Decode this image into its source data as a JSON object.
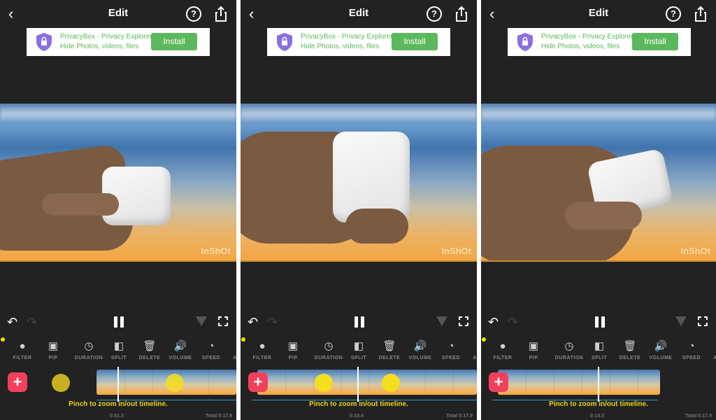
{
  "common": {
    "title": "Edit",
    "back_icon": "chevron-left-icon",
    "help_icon": "help-icon",
    "help_glyph": "?",
    "share_icon": "share-icon",
    "ad": {
      "line1": "PrivacyBox - Privacy Explorer",
      "line2": "Hide Photos, videos, files",
      "button": "Install"
    },
    "watermark": "InShOt",
    "undo_glyph": "↶",
    "redo_glyph": "↷",
    "add_glyph": "+",
    "hint": "Pinch to zoom in/out timeline.",
    "total": "Total 0:17.9",
    "tools": [
      {
        "label": "FILTER",
        "icon": "filter-icon",
        "glyph": "●"
      },
      {
        "label": "PIP",
        "icon": "pip-icon",
        "glyph": "▣"
      },
      {
        "label": "DURATION",
        "icon": "clock-icon",
        "glyph": "◷"
      },
      {
        "label": "SPLIT",
        "icon": "split-icon",
        "glyph": "◧"
      },
      {
        "label": "DELETE",
        "icon": "trash-icon",
        "glyph": "🗑"
      },
      {
        "label": "VOLUME",
        "icon": "volume-icon",
        "glyph": "🔊"
      },
      {
        "label": "SPEED",
        "icon": "speed-icon",
        "glyph": "◔"
      },
      {
        "label": "ANI",
        "icon": "animation-icon",
        "glyph": ""
      }
    ],
    "colors": {
      "accent_green": "#5cb85c",
      "add_red": "#f2405a",
      "hint_yellow": "#e8d21a",
      "marker_yellow": "#f4de1e",
      "audio_blue": "#2aa0d8"
    }
  },
  "panels": [
    {
      "time": "0:01.3"
    },
    {
      "time": "0:10.4"
    },
    {
      "time": "0:14.3"
    }
  ]
}
